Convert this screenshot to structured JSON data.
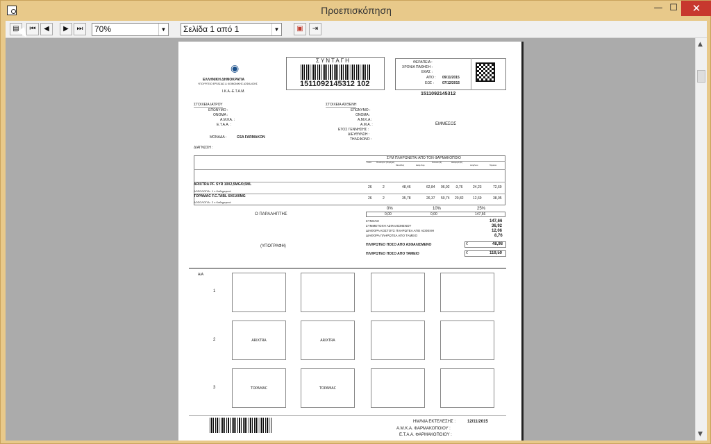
{
  "window": {
    "title": "Προεπισκόπηση"
  },
  "controls": {
    "minimize": "—",
    "maximize": "☐",
    "close": "✕"
  },
  "toolbar": {
    "zoom_value": "70%",
    "page_value": "Σελίδα 1 από 1"
  },
  "doc": {
    "title": "ΣΥΝΤΑΓΗ",
    "barcode_number": "1511092145312 102",
    "org1": "ΕΛΛΗΝΙΚΗ ΔΗΜΟΚΡΑΤΙΑ",
    "org2": "ΥΠΟΥΡΓΕΙΟ ΕΡΓΑΣΙΑΣ & ΚΟΙΝΩΝΙΚΗΣ ΑΣΦΑΛΙΣΗΣ",
    "org3": "Ι.Κ.Α.-Ε.Τ.Α.Μ.",
    "therapy_label": "ΘΕΡΑΠΕΙΑ :",
    "chronic_label": "ΧΡΟΝΙΑ ΠΑΘΗΣΗ :",
    "ekas_label": "ΕΚΑΣ :",
    "from_label": "ΑΠΟ :",
    "from_value": "09/11/2015",
    "to_label": "ΕΩΣ :",
    "to_value": "07/12/2015",
    "qr_number": "1511092145312",
    "doctor_section": "ΣΤΟΙΧΕΙΑ ΙΑΤΡΟΥ",
    "patient_section": "ΣΤΟΙΧΕΙΑ ΑΣΘΕΝΗ",
    "doctor_fields": [
      "ΕΠΩΝΥΜΟ :",
      "ΟΝΟΜΑ :",
      "Α.Μ.ΚΑ. :",
      "Ε.Τ.Α.Α. :"
    ],
    "patient_fields": [
      "ΕΠΩΝΥΜΟ :",
      "ΟΝΟΜΑ :",
      "Α.Μ.Κ.Α :",
      "Α.Μ.Α. :",
      "ΕΤΟΣ ΓΕΝΝΗΣΗΣ :",
      "ΔΙΕΥΘΥΝΣΗ :",
      "ΤΗΛΕΦΩΝΟ :"
    ],
    "unit_label": "ΜΟΝΑΔΑ :",
    "unit_value": "CSA FARMAKON",
    "diagnosis_label": "ΔΙΑΓΝΩΣΗ :",
    "patient_value": "ΕΜΜΕΣΟΣ",
    "pharmacy_header": "ΣΥΜ ΠΛΗΡΩΝΕΤΑΙ ΑΠΟ ΤΟΝ ΦΑΡΜΑΚΟΠΟΙΟ",
    "col_headers": [
      "Συσκ.",
      "Ποσότητα (Τεμάχια)",
      "Μονάδας",
      "Διαφ.Συμ.",
      "Σύνολο (€)",
      "Διαφορά (€)",
      "Ασφ/νου",
      "Ταμείου"
    ],
    "items": [
      {
        "name": "ARIXTRA PF. SYR 10X2,5MG/0,5ML",
        "sub": "ΔΟΣΟΛΟΓΙΑ : 1 x Καθημερινά",
        "vals": [
          "26",
          "2",
          "48,46",
          "62,84",
          "96,92",
          "-3,76",
          "24,23",
          "72,69"
        ]
      },
      {
        "name": "TOPAMAC F.C.TABL 60X100MG",
        "sub": "ΔΟΣΟΛΟΓΙΑ : 2 x Καθημερινά",
        "vals": [
          "26",
          "2",
          "35,78",
          "26,37",
          "50,74",
          "20,82",
          "12,69",
          "38,05"
        ]
      }
    ],
    "percents": [
      "0%",
      "10%",
      "25%"
    ],
    "percent_vals": [
      "0,00",
      "0,00",
      "147,66"
    ],
    "receiver": "Ο ΠΑΡΑΛΗΠΤΗΣ",
    "signature": "(ΥΠΟΓΡΑΦΗ)",
    "totals": [
      {
        "label": "ΣΥΝΟΛΟ",
        "value": "147,66"
      },
      {
        "label": "ΣΥΜΜΕΤΟΧΗ ΑΣΦΑΛΙΣΜΕΝΟΥ",
        "value": "36,92"
      },
      {
        "label": "ΔΙΑΦΟΡΑ ΚΟΣΤΟΥΣ ΠΛΗΡΩΤΕΑ ΑΠΟ ΑΣΘΕΝΗ",
        "value": "12,06"
      },
      {
        "label": "ΔΙΑΦΟΡΑ ΠΛΗΡΩΤΕΑ ΑΠΟ ΤΑΜΕΙΟ",
        "value": "8,76"
      }
    ],
    "paid_insured_label": "ΠΛΗΡΩΤΕΟ ΠΟΣΟ ΑΠΟ ΑΣΦΑΛΙΣΜΕΝΟ",
    "paid_insured_value": "48,98",
    "paid_fund_label": "ΠΛΗΡΩΤΕΟ ΠΟΣΟ ΑΠΟ ΤΑΜΕΙΟ",
    "paid_fund_value": "119,50",
    "aa_label": "Α/Α",
    "row_numbers": [
      "1",
      "2",
      "3"
    ],
    "grid_labels": [
      "",
      "",
      "",
      "",
      "ARIXTRA",
      "ARIXTRA",
      "",
      "",
      "TOPAMAC",
      "TOPAMAC",
      "",
      ""
    ],
    "exec_date_label": "ΗΜ/ΝΙΑ ΕΚΤΕΛΕΣΗΣ :",
    "exec_date_value": "12/11/2015",
    "amka_pharm_label": "Α.Μ.Κ.Α. ΦΑΡΜΑΚΟΠΟΙΟΥ :",
    "etaa_pharm_label": "Ε.Τ.Α.Α. ΦΑΡΜΑΚΟΠΟΙΟΥ :"
  }
}
